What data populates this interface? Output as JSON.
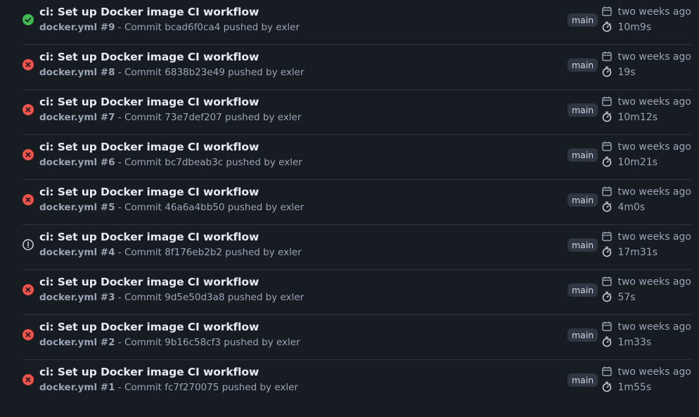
{
  "colors": {
    "success": "#3fb950",
    "failure": "#f0524a",
    "neutral": "#d1d7e0",
    "background": "#171b22"
  },
  "icons": {
    "success": "check-circle-icon",
    "failure": "x-circle-icon",
    "neutral": "alert-circle-icon",
    "date": "calendar-icon",
    "duration": "stopwatch-icon"
  },
  "runs": [
    {
      "status": "success",
      "title": "ci: Set up Docker image CI workflow",
      "workflow": "docker.yml #9",
      "detail": " - Commit bcad6f0ca4 pushed by exler",
      "branch": "main",
      "when": "two weeks ago",
      "duration": "10m9s"
    },
    {
      "status": "failure",
      "title": "ci: Set up Docker image CI workflow",
      "workflow": "docker.yml #8",
      "detail": " - Commit 6838b23e49 pushed by exler",
      "branch": "main",
      "when": "two weeks ago",
      "duration": "19s"
    },
    {
      "status": "failure",
      "title": "ci: Set up Docker image CI workflow",
      "workflow": "docker.yml #7",
      "detail": " - Commit 73e7def207 pushed by exler",
      "branch": "main",
      "when": "two weeks ago",
      "duration": "10m12s"
    },
    {
      "status": "failure",
      "title": "ci: Set up Docker image CI workflow",
      "workflow": "docker.yml #6",
      "detail": " - Commit bc7dbeab3c pushed by exler",
      "branch": "main",
      "when": "two weeks ago",
      "duration": "10m21s"
    },
    {
      "status": "failure",
      "title": "ci: Set up Docker image CI workflow",
      "workflow": "docker.yml #5",
      "detail": " - Commit 46a6a4bb50 pushed by exler",
      "branch": "main",
      "when": "two weeks ago",
      "duration": "4m0s"
    },
    {
      "status": "neutral",
      "title": "ci: Set up Docker image CI workflow",
      "workflow": "docker.yml #4",
      "detail": " - Commit 8f176eb2b2 pushed by exler",
      "branch": "main",
      "when": "two weeks ago",
      "duration": "17m31s"
    },
    {
      "status": "failure",
      "title": "ci: Set up Docker image CI workflow",
      "workflow": "docker.yml #3",
      "detail": " - Commit 9d5e50d3a8 pushed by exler",
      "branch": "main",
      "when": "two weeks ago",
      "duration": "57s"
    },
    {
      "status": "failure",
      "title": "ci: Set up Docker image CI workflow",
      "workflow": "docker.yml #2",
      "detail": " - Commit 9b16c58cf3 pushed by exler",
      "branch": "main",
      "when": "two weeks ago",
      "duration": "1m33s"
    },
    {
      "status": "failure",
      "title": "ci: Set up Docker image CI workflow",
      "workflow": "docker.yml #1",
      "detail": " - Commit fc7f270075 pushed by exler",
      "branch": "main",
      "when": "two weeks ago",
      "duration": "1m55s"
    }
  ]
}
